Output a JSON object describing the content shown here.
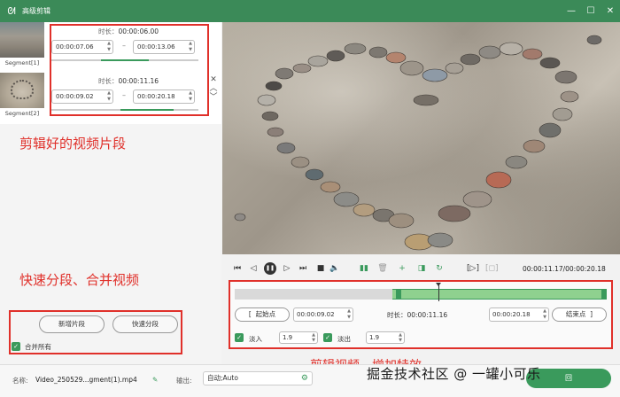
{
  "window": {
    "title": "高级剪辑",
    "logo_icon": "rabbit-logo-icon",
    "controls": [
      "minimize-icon",
      "maximize-icon",
      "close-icon"
    ]
  },
  "segments": [
    {
      "label": "Segment[1]",
      "duration_label": "时长：",
      "duration": "00:00:06.00",
      "start": "00:00:07.06",
      "end": "00:00:13.06",
      "progress": 0.34
    },
    {
      "label": "Segment[2]",
      "duration_label": "时长：",
      "duration": "00:00:11.16",
      "start": "00:00:09.02",
      "end": "00:00:20.18",
      "progress": 0.36
    }
  ],
  "annotations": {
    "clipped_segments": "剪辑好的视频片段",
    "split_merge": "快速分段、合并视频",
    "edit_effects": "剪辑视频、增加特效"
  },
  "left_actions": {
    "new_segment": "新增片段",
    "quick_split": "快速分段",
    "merge_all": "合并所有",
    "merge_all_checked": true
  },
  "player": {
    "time_readout": "00:00:11.17/00:00:20.18",
    "controls": [
      "jump-start-icon",
      "step-back-icon",
      "pause-icon",
      "step-forward-icon",
      "jump-end-icon",
      "stop-icon",
      "volume-icon",
      "split-icon",
      "delete-icon",
      "add-icon",
      "copy-icon",
      "undo-icon",
      "crop-icon",
      "snapshot-icon"
    ]
  },
  "editor": {
    "start_label": "起始点",
    "start": "00:00:09.02",
    "duration_label": "时长：",
    "duration": "00:00:11.16",
    "end": "00:00:20.18",
    "end_label": "结束点",
    "fade_in_label": "淡入",
    "fade_in": "1.9",
    "fade_out_label": "淡出",
    "fade_out": "1.9"
  },
  "bottom": {
    "name_label": "名称:",
    "name_value": "Video_250529...gment(1).mp4",
    "output_label": "输出:",
    "output_value": "自动;Auto",
    "ok_label": "回",
    "watermark": "掘金技术社区 @ 一罐小可乐"
  },
  "colors": {
    "accent": "#3b8a58",
    "annotation_red": "#e0302a"
  }
}
